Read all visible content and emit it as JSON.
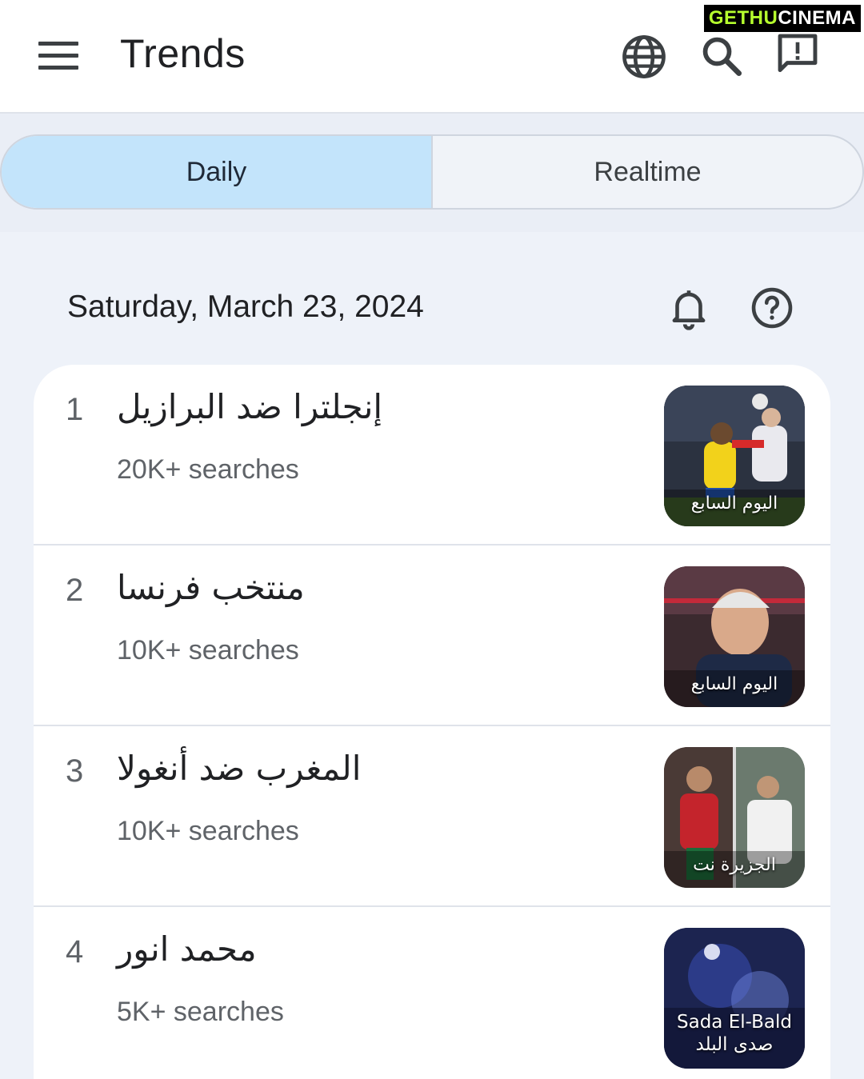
{
  "app": {
    "title": "Trends"
  },
  "watermark": {
    "part1": "GETHU",
    "part2": "CINEMA"
  },
  "icons": {
    "menu": "menu-icon",
    "globe": "globe-icon",
    "search": "search-icon",
    "feedback": "feedback-icon",
    "bell": "bell-icon",
    "help": "help-icon"
  },
  "tabs": [
    {
      "label": "Daily",
      "active": true
    },
    {
      "label": "Realtime",
      "active": false
    }
  ],
  "date": "Saturday, March 23, 2024",
  "trends": [
    {
      "rank": "1",
      "query": "إنجلترا ضد البرازيل",
      "searches": "20K+ searches",
      "source": "اليوم السابع",
      "source_line2": ""
    },
    {
      "rank": "2",
      "query": "منتخب فرنسا",
      "searches": "10K+ searches",
      "source": "اليوم السابع",
      "source_line2": ""
    },
    {
      "rank": "3",
      "query": "المغرب ضد أنغولا",
      "searches": "10K+ searches",
      "source": "الجزيرة نت",
      "source_line2": ""
    },
    {
      "rank": "4",
      "query": "محمد انور",
      "searches": "5K+ searches",
      "source": "Sada El-Bald",
      "source_line2": "صدى البلد"
    }
  ],
  "colors": {
    "active_tab": "#c3e4fb",
    "background": "#eef2f9",
    "card": "#ffffff",
    "icon": "#3c4043"
  }
}
